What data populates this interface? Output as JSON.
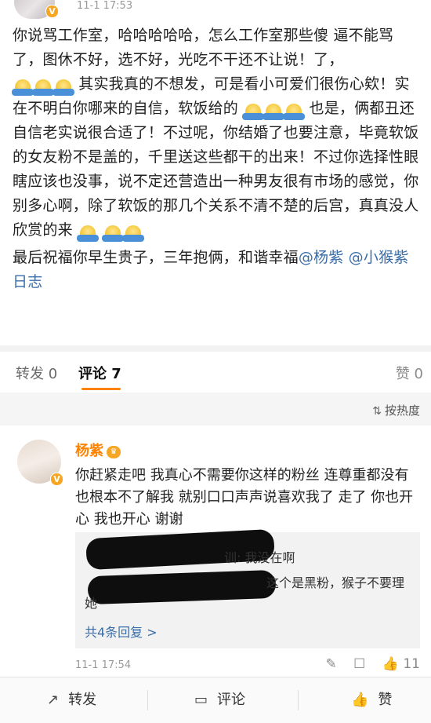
{
  "post": {
    "timestamp": "11-1 17:53",
    "para1_a": "你说骂工作室，哈哈哈哈哈，怎么工作室那些傻  逼不能骂了，图休不好，选不好，光吃不干还不让说！了，",
    "para1_b": "其实我真的不想发，可是看小可爱们很伤心欸！实在不明白你哪来的自信，软饭给的",
    "para1_c": "也是，俩都丑还自信老实说很合适了！不过呢，你结婚了也要注意，毕竟软饭的女友粉不是盖的，千里送这些都干的出来！不过你选择性眼瞎应该也没事，说不定还营造出一种男友很有市场的感觉，你别多心啊，除了软饭的那几个关系不清不楚的后宫，真真没人欣赏的来",
    "para2": "最后祝福你早生贵子，三年抱俩，和谐幸福",
    "mention1": "@杨紫",
    "mention2": "@小猴紫日志"
  },
  "tabs": {
    "repost": "转发 0",
    "comment": "评论 7",
    "like": "赞 0"
  },
  "sort": {
    "label": "按热度"
  },
  "comment": {
    "name": "杨紫",
    "text": "你赶紧走吧 我真心不需要你这样的粉丝 连尊重都没有 也根本不了解我 就别口口声声说喜欢我了 走了 你也开心 我也开心 谢谢",
    "reply1_visible": "训: 我没在啊",
    "reply2_visible": "这个是黑粉，猴子不要理她",
    "more": "共4条回复 >",
    "time": "11-1 17:54",
    "likes": "11"
  },
  "bottom": {
    "repost": "转发",
    "comment": "评论",
    "like": "赞"
  },
  "colors": {
    "accent": "#ff8200",
    "link": "#3b6ea8"
  }
}
